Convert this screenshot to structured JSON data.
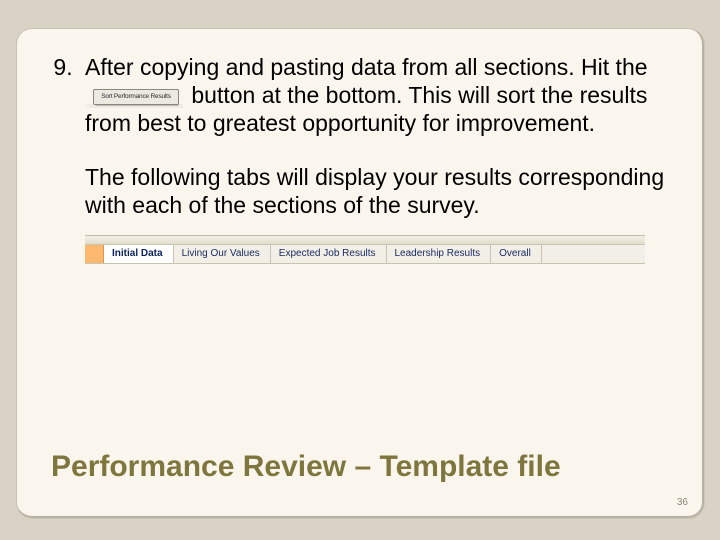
{
  "step": {
    "start_number": 9,
    "text_before_button": "After copying and pasting data from all sections.  Hit the ",
    "button_label": "Sort Performance Results",
    "text_after_button": " button at the bottom.  This will sort the results from best to greatest opportunity for improvement."
  },
  "paragraph2": "The following tabs will display your results corresponding with each of the sections of the survey.",
  "tabs": {
    "items": [
      {
        "label": "Initial Data",
        "active": true
      },
      {
        "label": "Living Our Values",
        "active": false
      },
      {
        "label": "Expected Job Results",
        "active": false
      },
      {
        "label": "Leadership Results",
        "active": false
      },
      {
        "label": "Overall",
        "active": false
      }
    ]
  },
  "title": "Performance Review – Template file",
  "page_number": "36"
}
